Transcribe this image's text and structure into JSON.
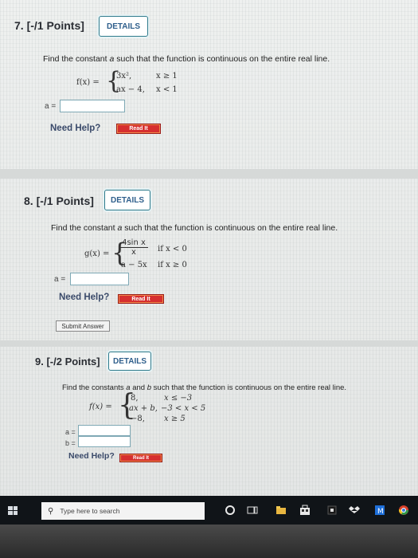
{
  "q7": {
    "header": "7. [-/1 Points]",
    "details": "DETAILS",
    "prompt_pre": "Find the constant ",
    "prompt_var": "a",
    "prompt_post": " such that the function is continuous on the entire real line.",
    "fname": "f(x) =",
    "piece1_expr": "3x²,",
    "piece1_cond": "x ≥ 1",
    "piece2_expr": "ax − 4,",
    "piece2_cond": "x < 1",
    "answer_label": "a =",
    "need_help": "Need Help?",
    "read_it": "Read It"
  },
  "q8": {
    "header": "8. [-/1 Points]",
    "details": "DETAILS",
    "prompt_pre": "Find the constant ",
    "prompt_var": "a",
    "prompt_post": " such that the function is continuous on the entire real line.",
    "fname": "g(x) =",
    "frac_num": "4sin x",
    "frac_den": "x",
    "piece1_cond": "if x < 0",
    "piece2_expr": "a − 5x",
    "piece2_cond": "if x ≥ 0",
    "answer_label": "a =",
    "need_help": "Need Help?",
    "read_it": "Read It",
    "submit": "Submit Answer"
  },
  "q9": {
    "header": "9. [-/2 Points]",
    "details": "DETAILS",
    "prompt_pre": "Find the constants ",
    "prompt_var_a": "a",
    "prompt_mid": " and ",
    "prompt_var_b": "b",
    "prompt_post": " such that the function is continuous on the entire real line.",
    "fname": "f(x) =",
    "piece1_expr": "8,",
    "piece1_cond": "x ≤ −3",
    "piece2_expr": "ax + b,",
    "piece2_cond": "−3 < x < 5",
    "piece3_expr": "−8,",
    "piece3_cond": "x ≥ 5",
    "answer_a_label": "a =",
    "answer_b_label": "b =",
    "need_help": "Need Help?",
    "read_it": "Read It"
  },
  "taskbar": {
    "search_placeholder": "Type here to search"
  },
  "colors": {
    "read_it_bg": "#d62f2f",
    "details_border": "#2f7b8c",
    "taskbar_bg": "#101418"
  }
}
